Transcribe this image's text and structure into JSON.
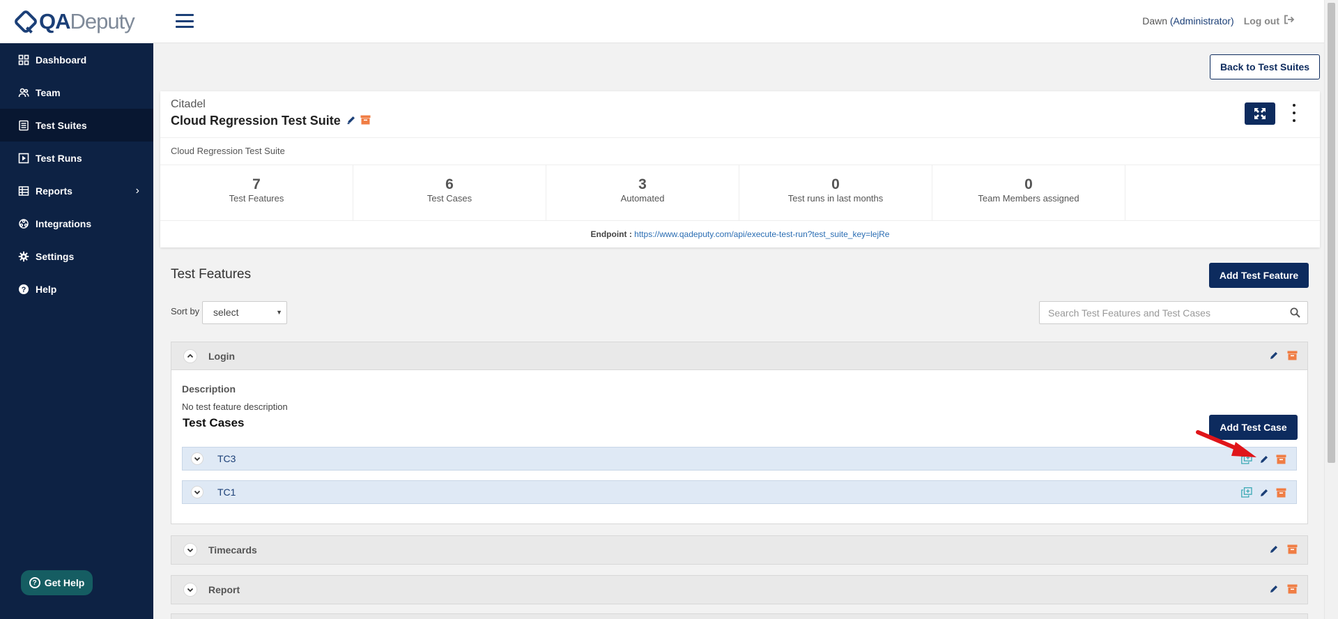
{
  "brand": {
    "logo_bold": "QA",
    "logo_light": "Deputy"
  },
  "sidebar": {
    "items": [
      {
        "label": "Dashboard",
        "icon": "dashboard-icon"
      },
      {
        "label": "Team",
        "icon": "team-icon"
      },
      {
        "label": "Test Suites",
        "icon": "test-suites-icon",
        "active": true
      },
      {
        "label": "Test Runs",
        "icon": "test-runs-icon"
      },
      {
        "label": "Reports",
        "icon": "reports-icon",
        "has_submenu": true
      },
      {
        "label": "Integrations",
        "icon": "integrations-icon"
      },
      {
        "label": "Settings",
        "icon": "gear-icon"
      },
      {
        "label": "Help",
        "icon": "help-icon"
      }
    ],
    "get_help_label": "Get Help"
  },
  "topbar": {
    "user_name": "Dawn",
    "user_role": "(Administrator)",
    "logout_label": "Log out"
  },
  "toolbar": {
    "back_label": "Back to Test Suites"
  },
  "suite": {
    "project": "Citadel",
    "title": "Cloud Regression Test Suite",
    "description": "Cloud Regression Test Suite",
    "stats": [
      {
        "value": "7",
        "label": "Test Features"
      },
      {
        "value": "6",
        "label": "Test Cases"
      },
      {
        "value": "3",
        "label": "Automated"
      },
      {
        "value": "0",
        "label": "Test runs in last months"
      },
      {
        "value": "0",
        "label": "Team Members assigned"
      }
    ],
    "endpoint_label": "Endpoint :",
    "endpoint_url": "https://www.qadeputy.com/api/execute-test-run?test_suite_key=lejRe"
  },
  "features": {
    "title": "Test Features",
    "add_label": "Add Test Feature",
    "sort_label": "Sort by",
    "sort_value": "select",
    "search_placeholder": "Search Test Features and Test Cases",
    "groups": [
      {
        "name": "Login",
        "expanded": true,
        "description_label": "Description",
        "description": "No test feature description",
        "test_cases_label": "Test Cases",
        "add_case_label": "Add Test Case",
        "cases": [
          {
            "name": "TC3"
          },
          {
            "name": "TC1"
          }
        ]
      },
      {
        "name": "Timecards",
        "expanded": false
      },
      {
        "name": "Report",
        "expanded": false
      }
    ]
  },
  "colors": {
    "sidebar_bg": "#0d2244",
    "primary": "#0d2b5e",
    "archive_orange": "#f07d44",
    "copy_teal": "#3aa9b4",
    "annotation_red": "#e0151a"
  }
}
